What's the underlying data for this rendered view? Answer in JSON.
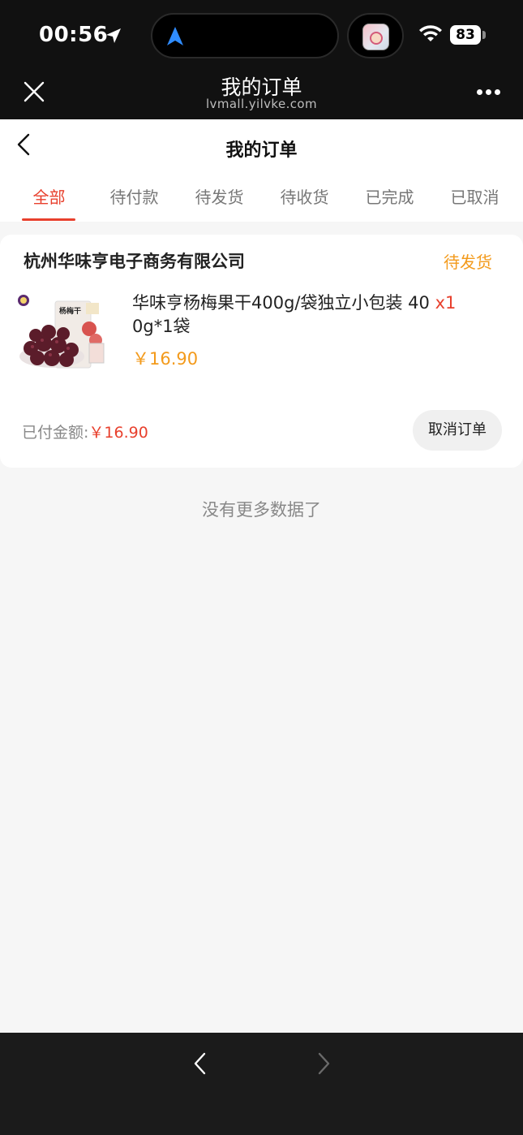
{
  "status_bar": {
    "time": "00:56",
    "battery": "83",
    "icons": [
      "location-arrow-icon",
      "navigation-icon",
      "app-icon",
      "wifi-icon",
      "battery-icon"
    ]
  },
  "browser": {
    "title": "我的订单",
    "url": "lvmall.yilvke.com",
    "icons": [
      "close-icon",
      "more-icon"
    ]
  },
  "page": {
    "title": "我的订单",
    "tabs": [
      {
        "label": "全部",
        "active": true
      },
      {
        "label": "待付款",
        "active": false
      },
      {
        "label": "待发货",
        "active": false
      },
      {
        "label": "待收货",
        "active": false
      },
      {
        "label": "已完成",
        "active": false
      },
      {
        "label": "已取消",
        "active": false
      }
    ]
  },
  "order": {
    "shop_name": "杭州华味亨电子商务有限公司",
    "status": "待发货",
    "product_name": "华味亨杨梅果干400g/袋独立小包装 40",
    "product_name_cont": "0g*1袋",
    "quantity": "x1",
    "price": "￥16.90",
    "paid_label": "已付金额:",
    "paid_amount": "￥16.90",
    "cancel_label": "取消订单",
    "thumb_brand_text": "杨梅干"
  },
  "footer": {
    "no_more": "没有更多数据了"
  },
  "colors": {
    "accent_red": "#e8402d",
    "status_orange": "#f39a1b",
    "dark_bg": "#111111"
  }
}
